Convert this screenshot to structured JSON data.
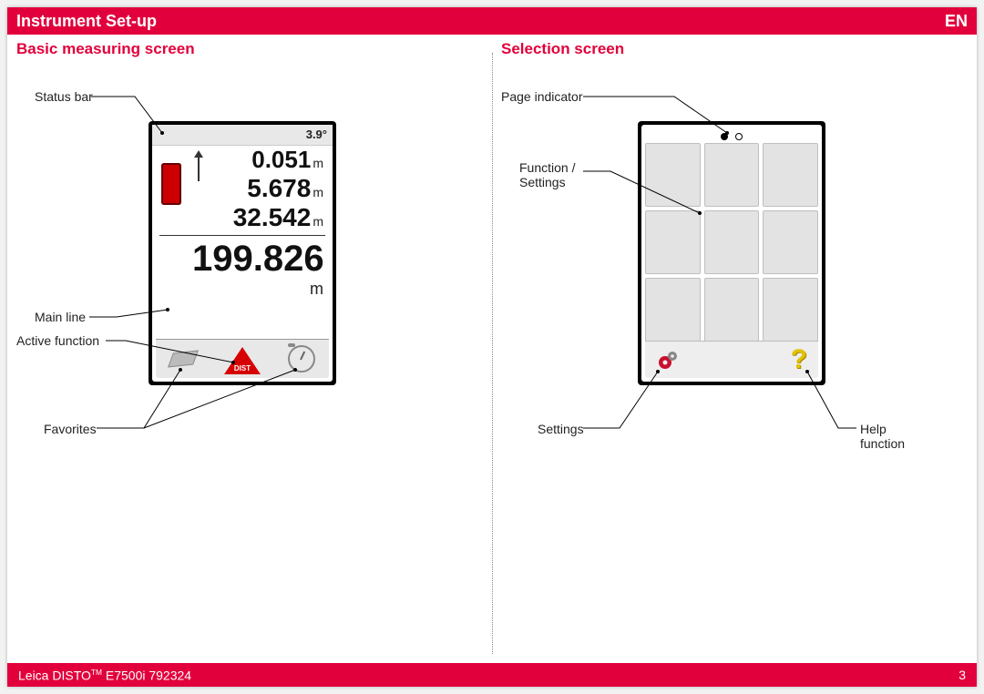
{
  "header": {
    "title": "Instrument Set-up",
    "lang": "EN"
  },
  "left": {
    "title": "Basic measuring screen",
    "callouts": {
      "status": "Status bar",
      "main_line": "Main line",
      "active_fn": "Active function",
      "favorites": "Favorites"
    },
    "screen": {
      "angle": "3.9°",
      "r1_val": "0.051",
      "r1_unit": "m",
      "r2_val": "5.678",
      "r2_unit": "m",
      "r3_val": "32.542",
      "r3_unit": "m",
      "main_val": "199.826",
      "main_unit": "m",
      "dist_label": "DIST"
    }
  },
  "right": {
    "title": "Selection screen",
    "callouts": {
      "page_ind": "Page indicator",
      "fn_settings": "Function / Settings",
      "settings": "Settings",
      "help": "Help function"
    }
  },
  "footer": {
    "product_pre": "Leica DISTO",
    "product_post": " E7500i 792324",
    "page": "3"
  }
}
